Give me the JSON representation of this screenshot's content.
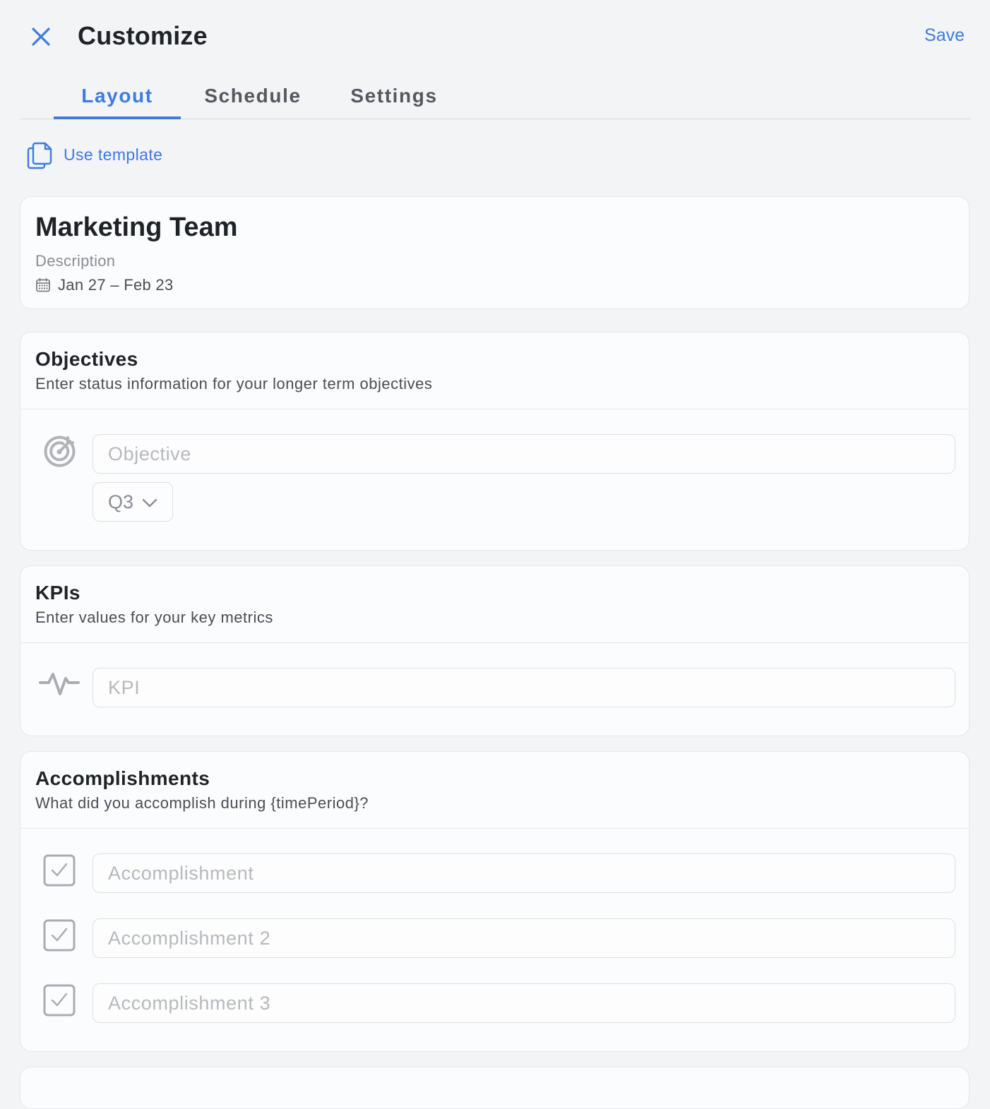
{
  "header": {
    "title": "Customize",
    "save_label": "Save",
    "accent_color": "#3d7be0"
  },
  "tabs": [
    {
      "label": "Layout",
      "active": true
    },
    {
      "label": "Schedule",
      "active": false
    },
    {
      "label": "Settings",
      "active": false
    }
  ],
  "toolbar": {
    "use_template_label": "Use template",
    "use_template_icon": "copy-document-icon"
  },
  "team": {
    "name": "Marketing Team",
    "description": "Description",
    "date_range": "Jan 27 – Feb 23",
    "date_icon": "calendar-icon"
  },
  "objectives": {
    "title": "Objectives",
    "subtitle": "Enter status information for your longer term objectives",
    "icon": "target-icon",
    "objective_placeholder": "Objective",
    "objective_value": "",
    "quarter_value": "Q3"
  },
  "kpis": {
    "title": "KPIs",
    "subtitle": "Enter values for your key metrics",
    "icon": "activity-pulse-icon",
    "kpi_placeholder": "KPI",
    "kpi_value": ""
  },
  "accomplishments": {
    "title": "Accomplishments",
    "subtitle": "What did you accomplish during {timePeriod}?",
    "icon": "checkbox-icon",
    "items": [
      {
        "placeholder": "Accomplishment",
        "value": ""
      },
      {
        "placeholder": "Accomplishment 2",
        "value": ""
      },
      {
        "placeholder": "Accomplishment 3",
        "value": ""
      }
    ]
  }
}
